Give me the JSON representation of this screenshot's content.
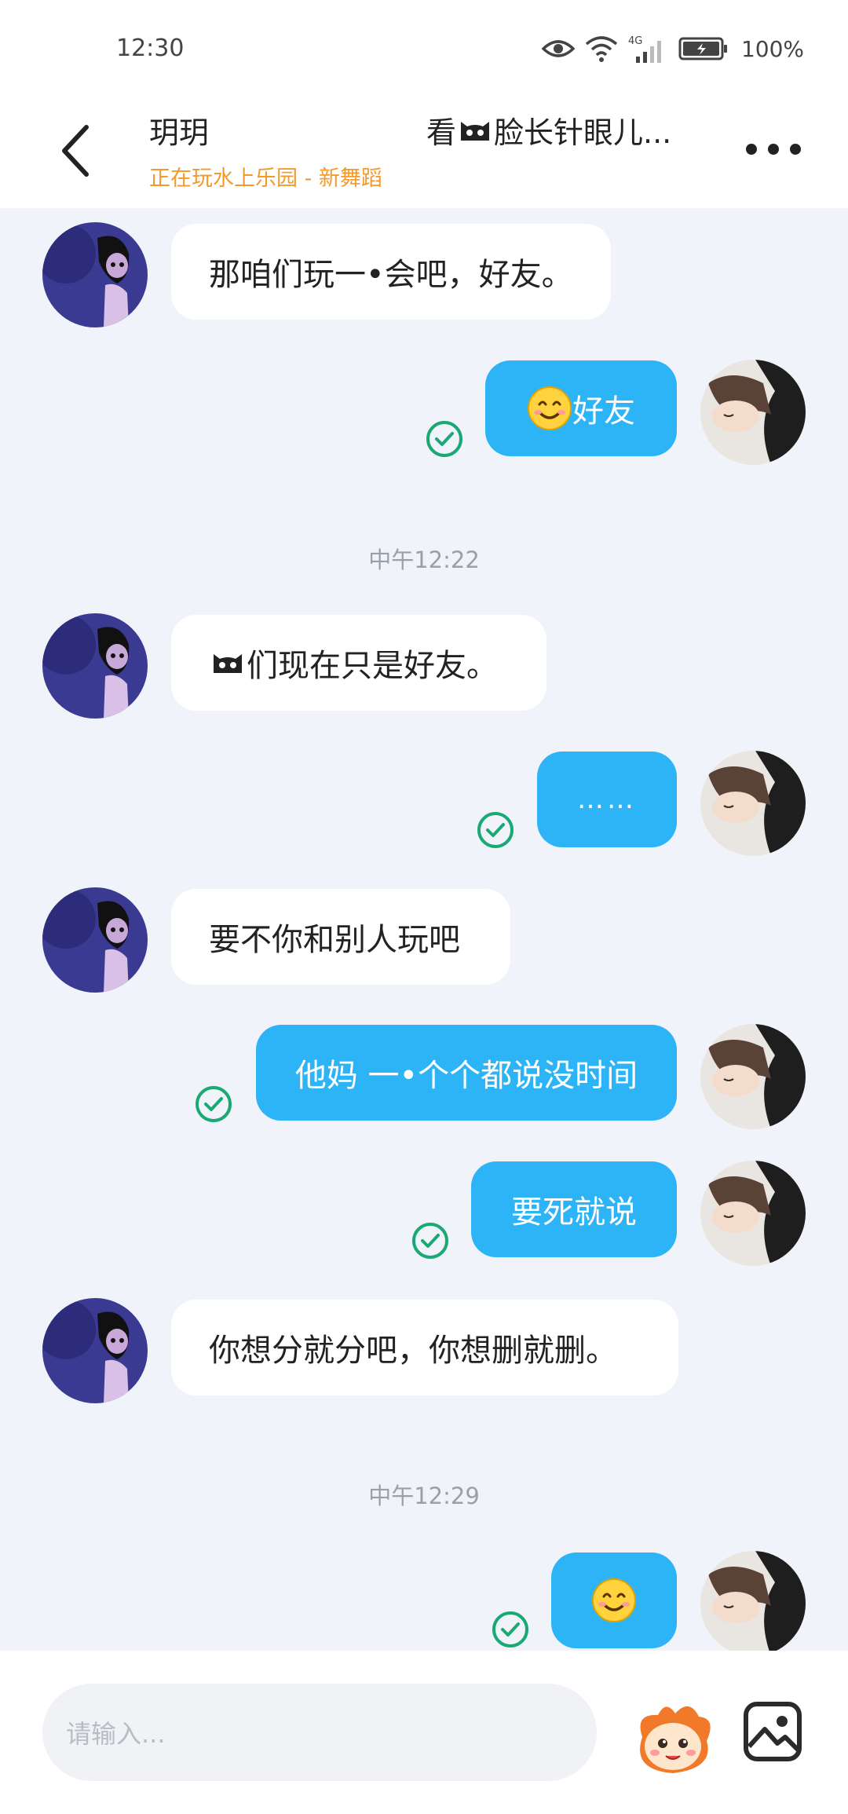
{
  "status_bar": {
    "time": "12:30",
    "network": "4G",
    "battery": "100%",
    "icons": [
      "eye-icon",
      "wifi-icon",
      "signal-icon",
      "battery-icon"
    ]
  },
  "header": {
    "contact_name": "玥玥",
    "contact_status": "正在玩水上乐园 - 新舞蹈",
    "title_prefix": "看",
    "title_suffix": "脸长针眼儿...",
    "icons": [
      "back-arrow-icon",
      "cat-face-icon",
      "more-icon"
    ]
  },
  "messages": [
    {
      "side": "in",
      "text": "那咱们玩一•会吧，好友。"
    },
    {
      "side": "out",
      "emoji": "smiling-face",
      "text": "好友",
      "status": "sent-check"
    },
    {
      "type": "time",
      "text": "中午12:22"
    },
    {
      "side": "in",
      "emoji": "cat-face",
      "text": "们现在只是好友。"
    },
    {
      "side": "out",
      "text": "……",
      "status": "sent-check"
    },
    {
      "side": "in",
      "text": "要不你和别人玩吧"
    },
    {
      "side": "out",
      "text": "他妈  一•个个都说没时间",
      "status": "sent-check"
    },
    {
      "side": "out",
      "text": "要死就说",
      "status": "sent-check"
    },
    {
      "side": "in",
      "text": "你想分就分吧，你想删就删。"
    },
    {
      "type": "time",
      "text": "中午12:29"
    },
    {
      "side": "out",
      "emoji": "smiling-face",
      "text": "",
      "status": "sent-check"
    }
  ],
  "input": {
    "placeholder": "请输入...",
    "icons": [
      "mascot-sticker-icon",
      "image-picker-icon"
    ]
  },
  "colors": {
    "outgoing_bubble": "#2db4f6",
    "incoming_bubble": "#ffffff",
    "background": "#f0f3f9",
    "status_text": "#f39a2b",
    "check": "#1aa874"
  }
}
